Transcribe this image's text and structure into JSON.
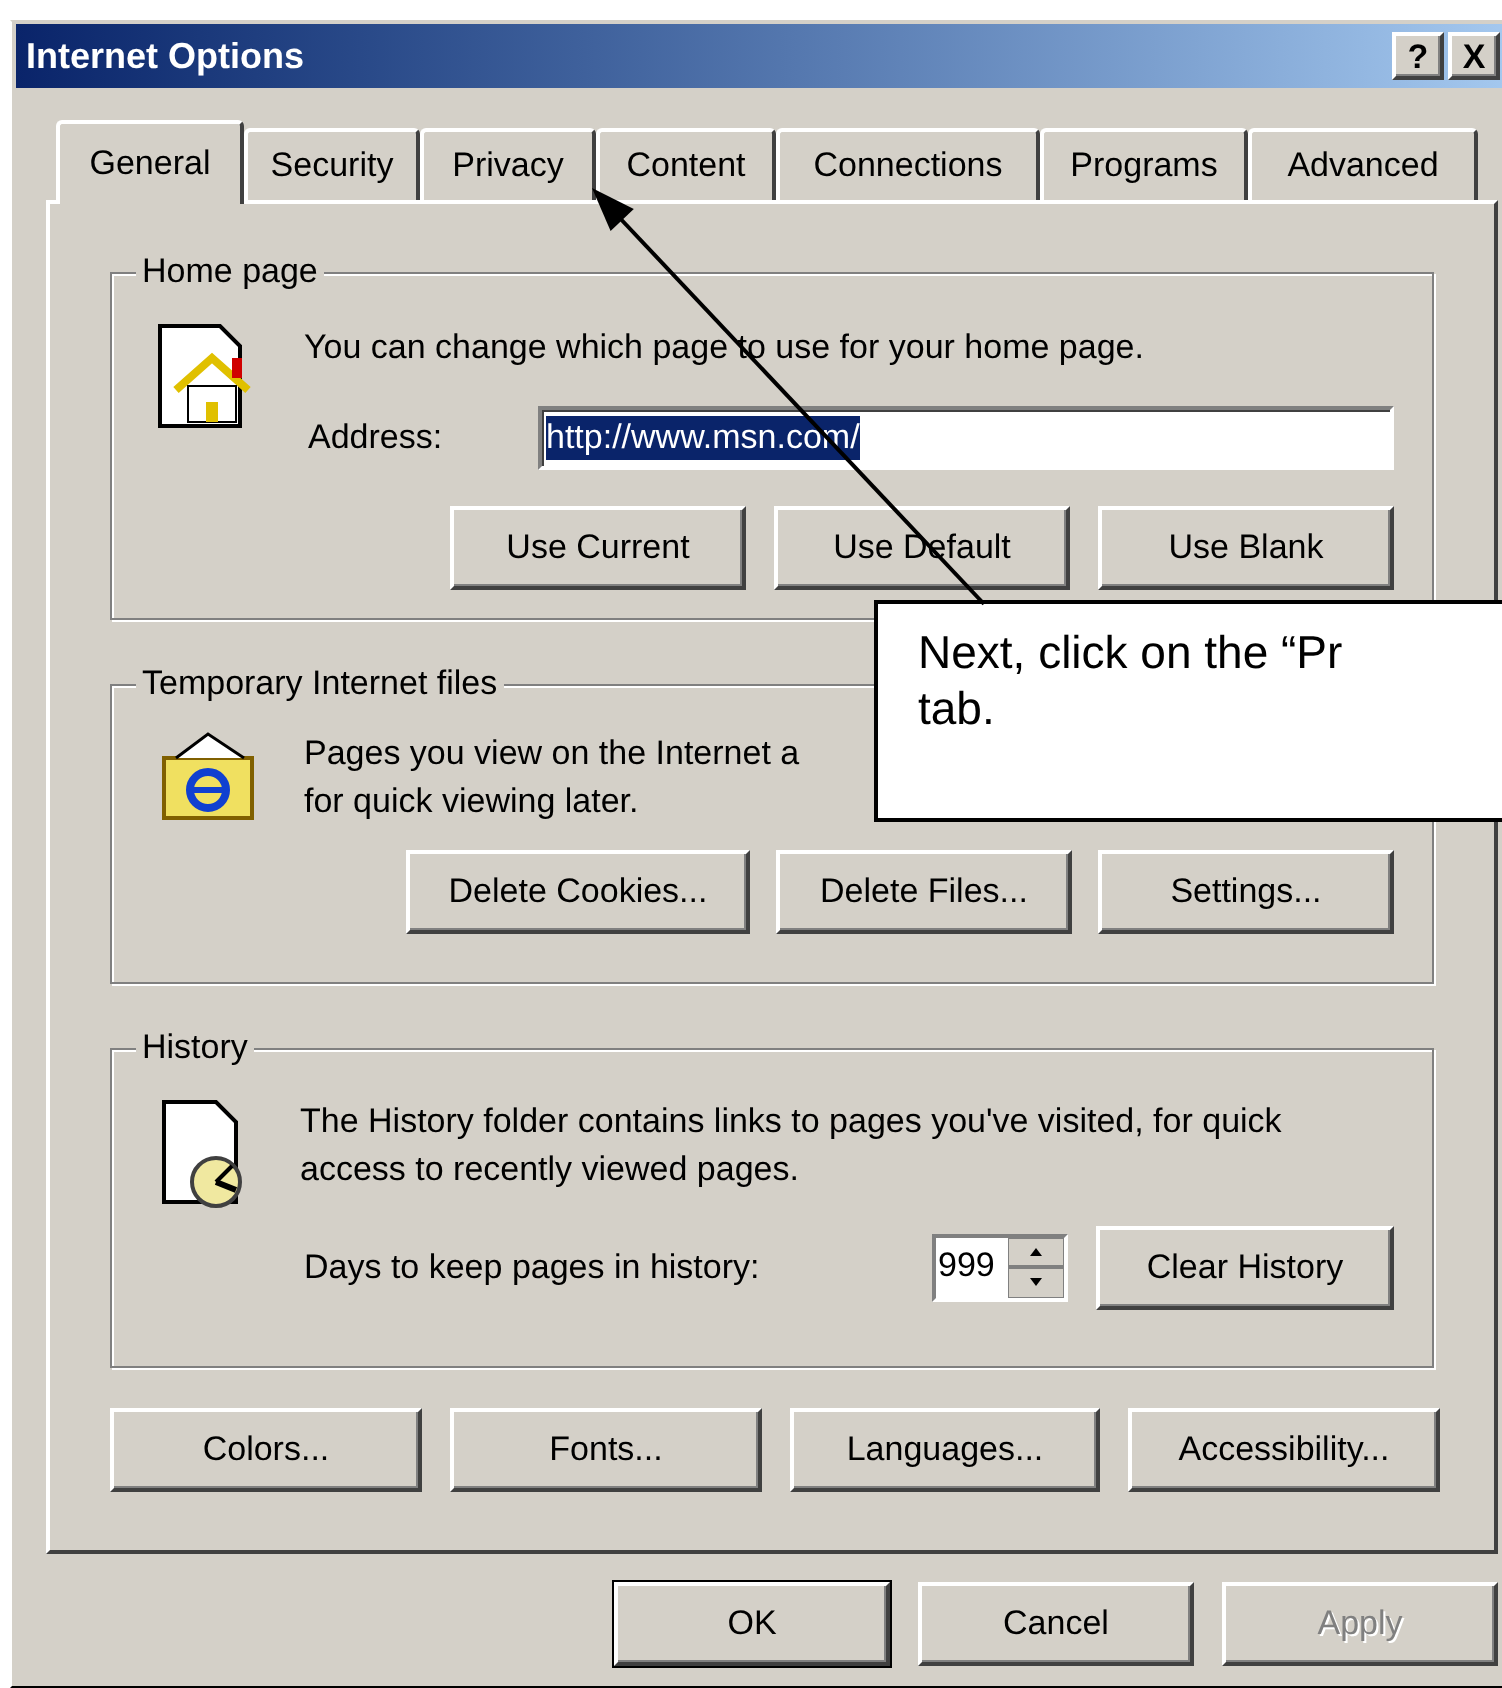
{
  "window": {
    "title": "Internet Options",
    "help_button": "?",
    "close_button": "X"
  },
  "tabs": [
    {
      "label": "General",
      "selected": true
    },
    {
      "label": "Security",
      "selected": false
    },
    {
      "label": "Privacy",
      "selected": false
    },
    {
      "label": "Content",
      "selected": false
    },
    {
      "label": "Connections",
      "selected": false
    },
    {
      "label": "Programs",
      "selected": false
    },
    {
      "label": "Advanced",
      "selected": false
    }
  ],
  "home_page": {
    "legend": "Home page",
    "description": "You can change which page to use for your home page.",
    "address_label": "Address:",
    "address_value": "http://www.msn.com/",
    "address_selected": true,
    "buttons": [
      "Use Current",
      "Use Default",
      "Use Blank"
    ]
  },
  "temporary_files": {
    "legend": "Temporary Internet files",
    "description_lines": [
      "Pages you view on the Internet a",
      "for quick viewing later."
    ],
    "buttons": [
      "Delete Cookies...",
      "Delete Files...",
      "Settings..."
    ]
  },
  "history": {
    "legend": "History",
    "description": "The History folder contains links to pages you've visited, for quick access to recently viewed pages.",
    "days_label": "Days to keep pages in history:",
    "days_value": "999",
    "clear_button": "Clear History"
  },
  "bottom_buttons": [
    "Colors...",
    "Fonts...",
    "Languages...",
    "Accessibility..."
  ],
  "dialog_buttons": [
    {
      "label": "OK",
      "default": true,
      "disabled": false
    },
    {
      "label": "Cancel",
      "default": false,
      "disabled": false
    },
    {
      "label": "Apply",
      "default": false,
      "disabled": true
    }
  ],
  "callout": {
    "lines": [
      "Next, click on the “Pr",
      "tab."
    ]
  }
}
